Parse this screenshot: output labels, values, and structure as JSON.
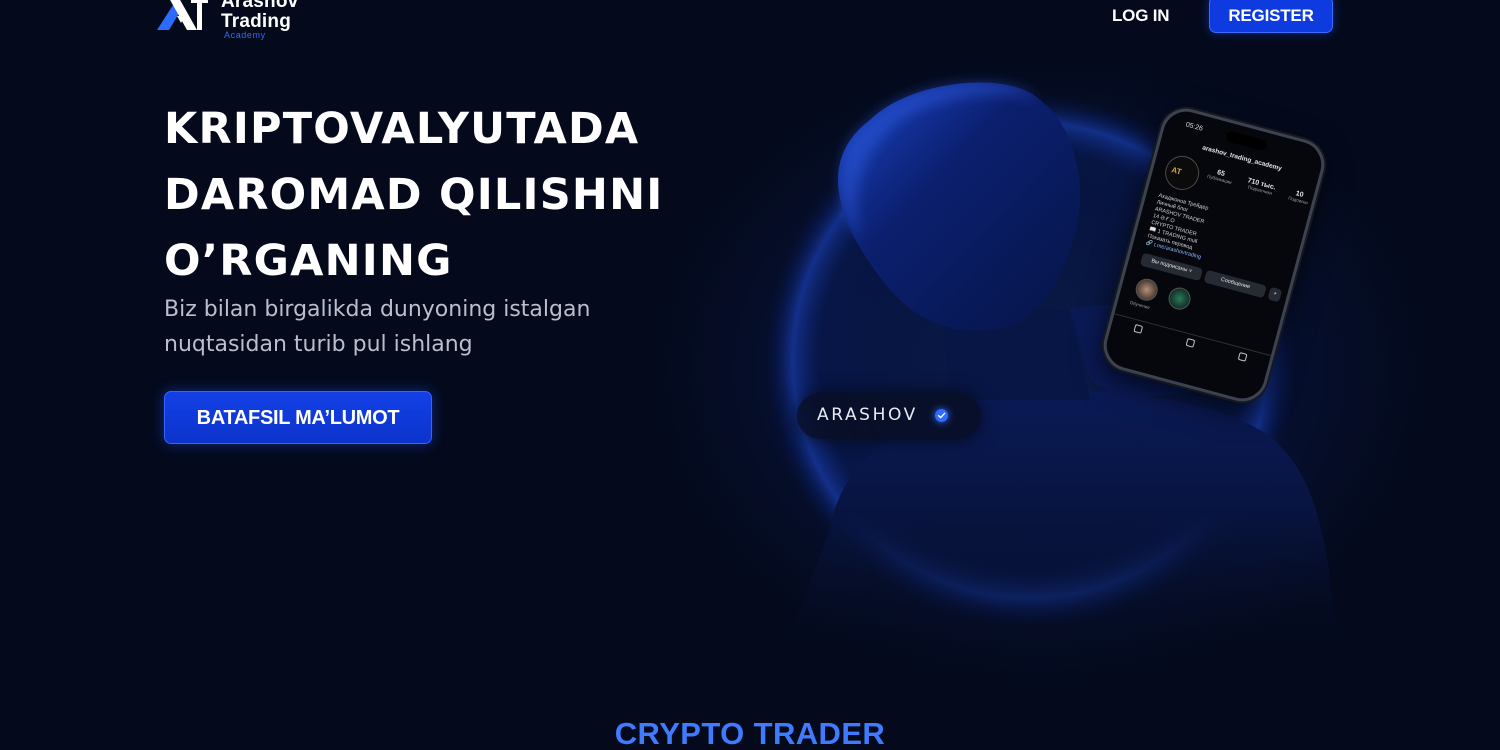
{
  "brand": {
    "name_line1": "Arashov",
    "name_line2": "Trading",
    "sub": "Academy",
    "accent_color": "#2d6bff"
  },
  "nav": {
    "login_label": "LOG IN",
    "register_label": "REGISTER"
  },
  "hero": {
    "title_lines": [
      "KRIPTOVALYUTADA",
      "DAROMAD QILISHNI",
      "O’RGANING"
    ],
    "subtitle_lines": [
      "Biz bilan birgalikda dunyoning istalgan",
      "nuqtasidan turib pul ishlang"
    ],
    "cta_label": "BATAFSIL MA’LUMOT"
  },
  "profile_badge": {
    "name": "ARASHOV",
    "verified_icon": "verified-check-icon"
  },
  "phone": {
    "time": "05:26",
    "handle": "arashov_trading_academy",
    "avatar_text": "AT",
    "stats": [
      {
        "value": "65",
        "label": "Публикации"
      },
      {
        "value": "710 тыс.",
        "label": "Подписчики"
      },
      {
        "value": "10",
        "label": "Подписки"
      }
    ],
    "bio_lines": [
      "Ахаджонов Трейдер",
      "Личный блог",
      "ARASHOV TRADER",
      "14 Ә.Ғ.О",
      "CRYPTO TRADER",
      "📖 1 TRADING mull",
      "Показать перевод",
      "🔗 t.me/arashovtrading"
    ],
    "follow_label": "Вы подписаны ˅",
    "message_label": "Сообщение",
    "highlight_label": "Обучение"
  },
  "section": {
    "title": "CRYPTO TRADER"
  }
}
